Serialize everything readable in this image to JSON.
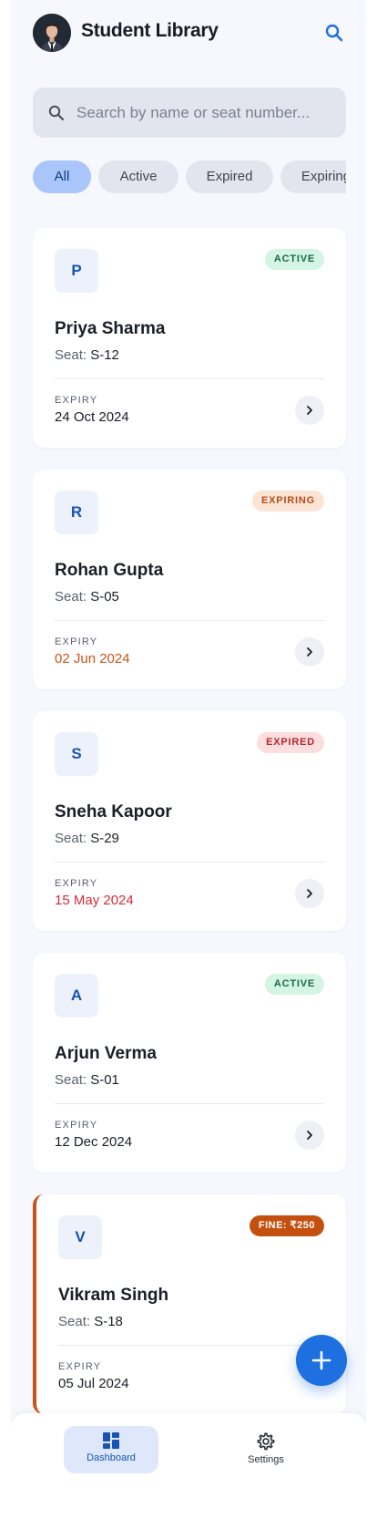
{
  "header": {
    "title": "Student Library"
  },
  "search": {
    "placeholder": "Search by name or seat number...",
    "value": ""
  },
  "filters": [
    "All",
    "Active",
    "Expired",
    "Expiring"
  ],
  "students": [
    {
      "initial": "P",
      "name": "Priya Sharma",
      "seat_label": "Seat:",
      "seat": "S-12",
      "status": "ACTIVE",
      "expiry_label": "EXPIRY",
      "expiry": "24 Oct 2024"
    },
    {
      "initial": "R",
      "name": "Rohan Gupta",
      "seat_label": "Seat:",
      "seat": "S-05",
      "status": "EXPIRING",
      "expiry_label": "EXPIRY",
      "expiry": "02 Jun 2024"
    },
    {
      "initial": "S",
      "name": "Sneha Kapoor",
      "seat_label": "Seat:",
      "seat": "S-29",
      "status": "EXPIRED",
      "expiry_label": "EXPIRY",
      "expiry": "15 May 2024"
    },
    {
      "initial": "A",
      "name": "Arjun Verma",
      "seat_label": "Seat:",
      "seat": "S-01",
      "status": "ACTIVE",
      "expiry_label": "EXPIRY",
      "expiry": "12 Dec 2024"
    },
    {
      "initial": "V",
      "name": "Vikram Singh",
      "seat_label": "Seat:",
      "seat": "S-18",
      "status": "FINE: ₹250",
      "expiry_label": "EXPIRY",
      "expiry": "05 Jul 2024"
    }
  ],
  "nav": {
    "dashboard": "Dashboard",
    "settings": "Settings"
  },
  "colors": {
    "primary": "#1e6fe0",
    "active": "#1a6a44",
    "expiring": "#c85415",
    "expired": "#d62a3b"
  },
  "icons": [
    "avatar",
    "search-icon",
    "chevron-right-icon",
    "plus-icon",
    "dashboard-icon",
    "gear-icon"
  ]
}
